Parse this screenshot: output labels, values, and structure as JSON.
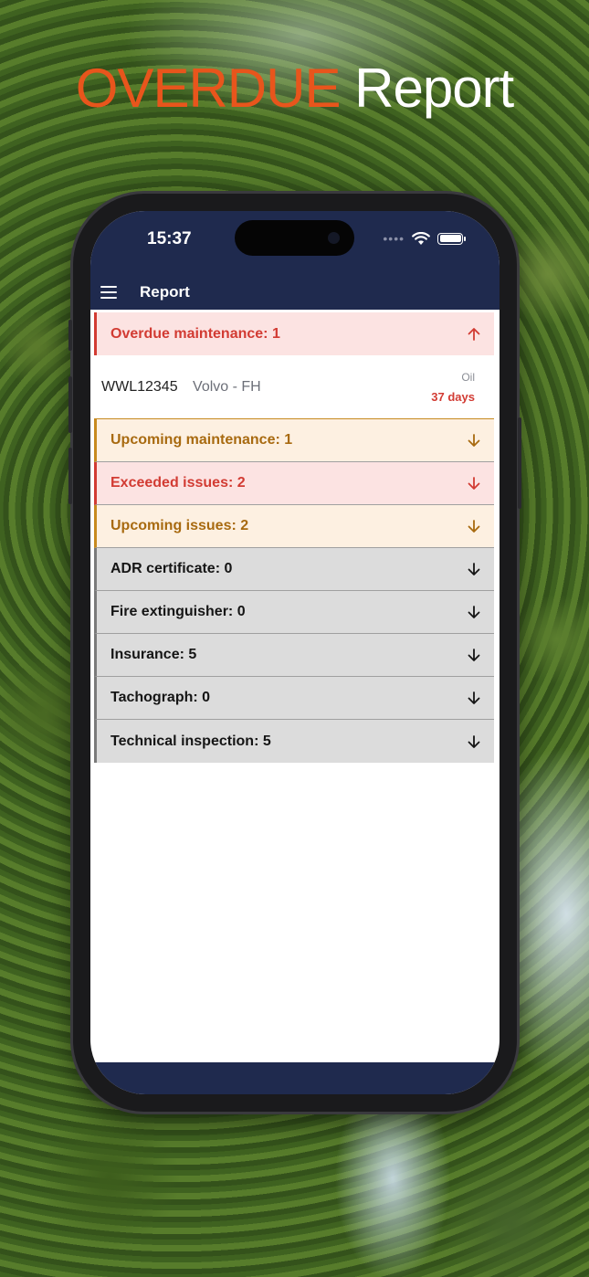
{
  "headline": {
    "accent": "OVERDUE",
    "main": "Report"
  },
  "status_bar": {
    "time": "15:37",
    "dots": "••••"
  },
  "appbar": {
    "title": "Report"
  },
  "sections": {
    "overdue": "Overdue maintenance: 1",
    "upcoming_maintenance": "Upcoming maintenance: 1",
    "exceeded_issues": "Exceeded issues: 2",
    "upcoming_issues": "Upcoming issues: 2",
    "adr": "ADR certificate: 0",
    "fire": "Fire extinguisher: 0",
    "insurance": "Insurance: 5",
    "tachograph": "Tachograph: 0",
    "technical": "Technical inspection: 5"
  },
  "overdue_items": [
    {
      "plate": "WWL12345",
      "model": "Volvo - FH",
      "type": "Oil",
      "days": "37 days"
    }
  ],
  "colors": {
    "accent": "#e8551c",
    "navy": "#1f2a4e",
    "red": "#d23b33",
    "orange": "#a86a10",
    "grey": "#dcdcdc"
  },
  "icons": {
    "menu": "hamburger-menu-icon",
    "expanded": "arrow-up-icon",
    "collapsed": "arrow-down-icon"
  }
}
